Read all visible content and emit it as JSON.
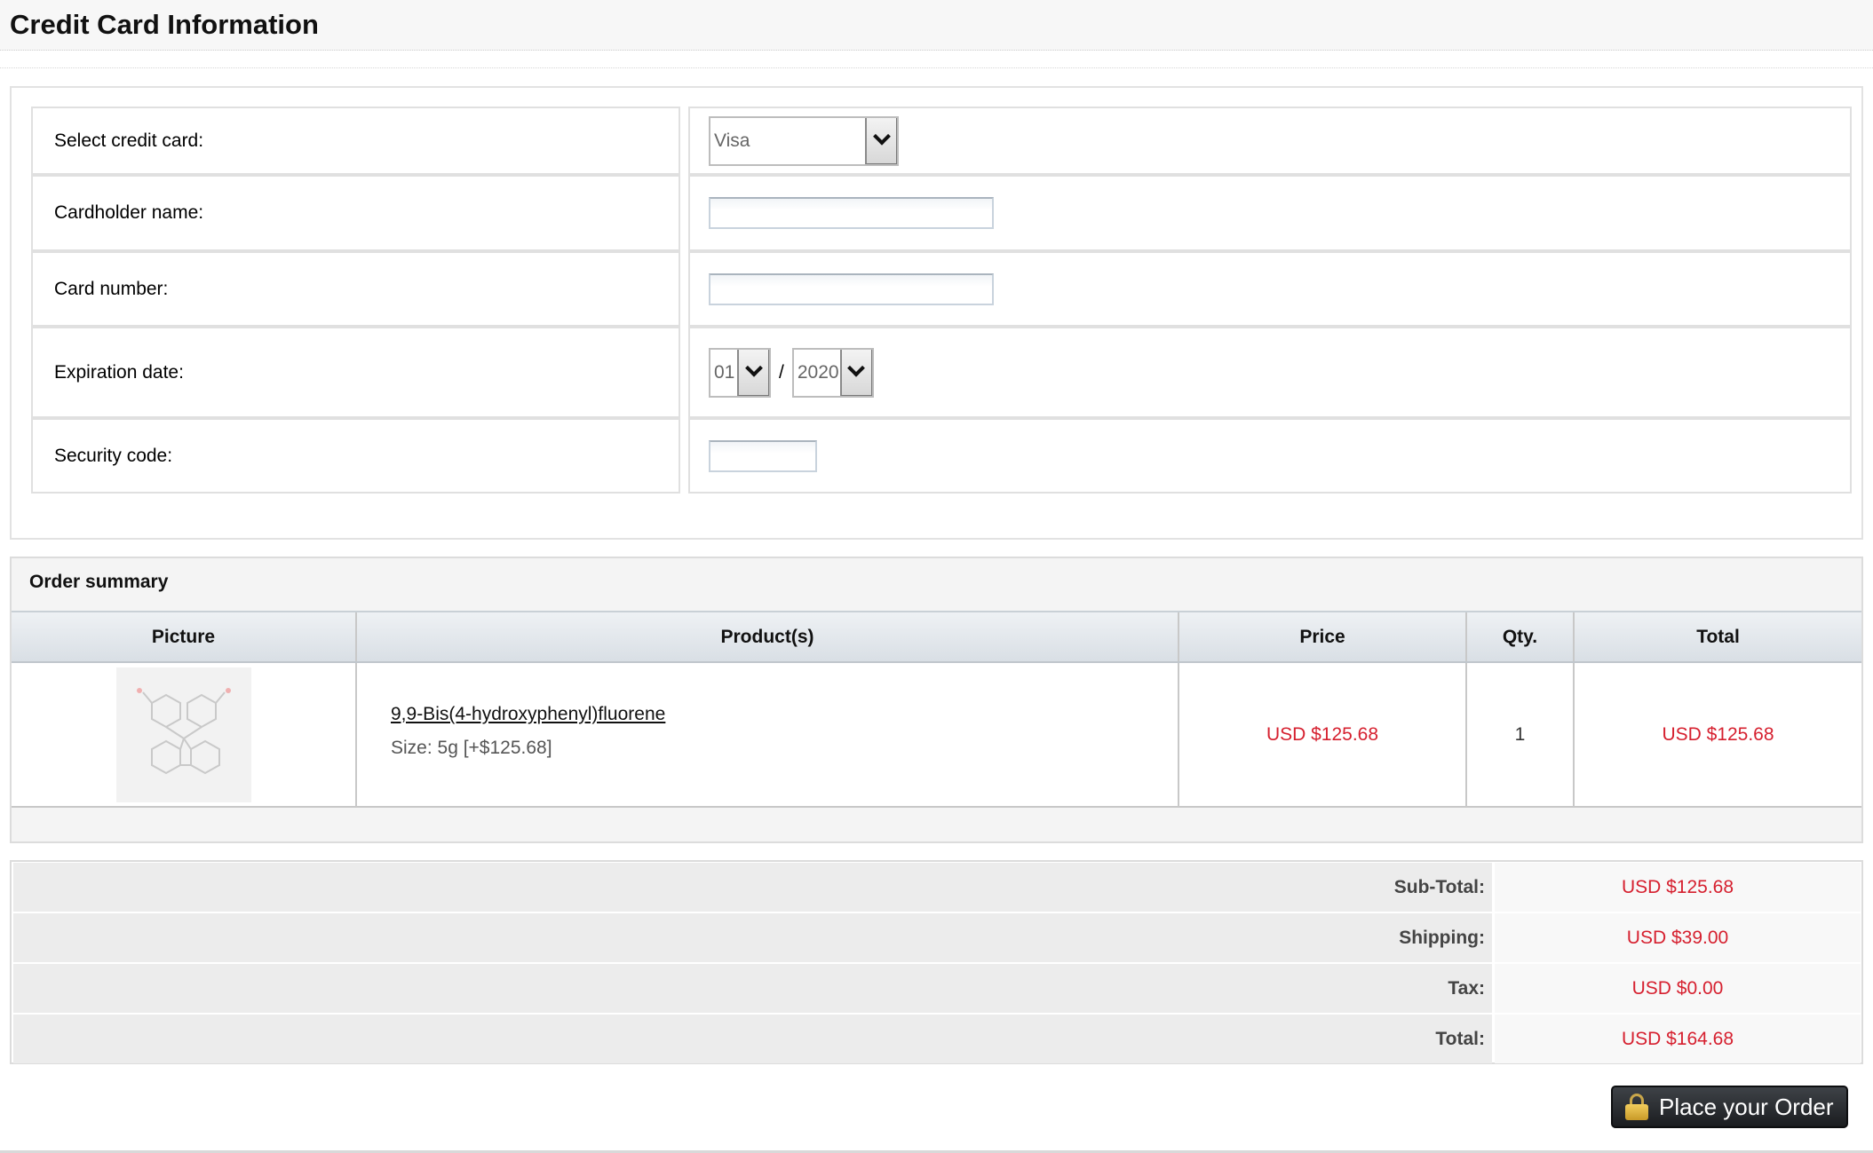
{
  "header": {
    "title": "Credit Card Information"
  },
  "credit_card": {
    "select_card_label": "Select credit card:",
    "selected_card": "Visa",
    "cardholder_label": "Cardholder name:",
    "cardholder_value": "",
    "card_number_label": "Card number:",
    "card_number_value": "",
    "expiration_label": "Expiration date:",
    "exp_month": "01",
    "exp_separator": "/",
    "exp_year": "2020",
    "security_label": "Security code:",
    "security_value": ""
  },
  "order_summary": {
    "title": "Order summary",
    "columns": [
      "Picture",
      "Product(s)",
      "Price",
      "Qty.",
      "Total"
    ],
    "items": [
      {
        "product": "9,9-Bis(4-hydroxyphenyl)fluorene",
        "size": "Size: 5g [+$125.68]",
        "price": "USD $125.68",
        "qty": "1",
        "total": "USD $125.68"
      }
    ]
  },
  "totals": {
    "subtotal_label": "Sub-Total:",
    "subtotal_value": "USD $125.68",
    "shipping_label": "Shipping:",
    "shipping_value": "USD $39.00",
    "tax_label": "Tax:",
    "tax_value": "USD $0.00",
    "total_label": "Total:",
    "total_value": "USD $164.68"
  },
  "actions": {
    "place_order": "Place your Order"
  },
  "colors": {
    "price_red": "#d6202f",
    "header_bg": "#f7f7f7",
    "button_dark": "#1b1d20"
  },
  "icons": {
    "select_arrow": "chevron-down-icon",
    "order_button": "lock-icon",
    "product_image": "molecule-structure"
  }
}
